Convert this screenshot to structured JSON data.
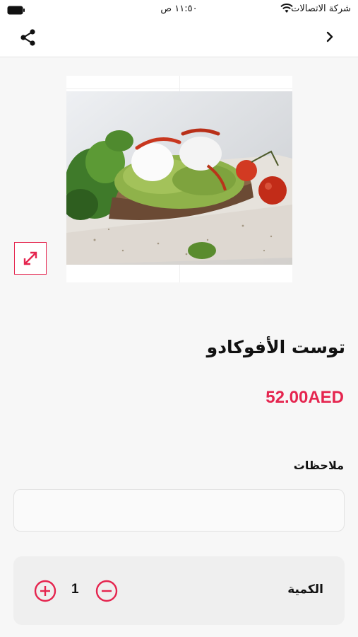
{
  "status_bar": {
    "carrier": "شركة الاتصالات",
    "time": "١١:٥٠ ص",
    "icons": [
      "wifi-icon",
      "battery-icon"
    ]
  },
  "nav": {
    "icons": [
      "share-icon",
      "chevron-right-icon"
    ]
  },
  "product": {
    "name": "توست الأفوكادو",
    "price": "52.00AED",
    "image_icon": "expand-icon"
  },
  "notes": {
    "label": "ملاحظات",
    "value": "",
    "placeholder": ""
  },
  "quantity": {
    "label": "الكمية",
    "value": "1",
    "icons": [
      "plus-circle-icon",
      "minus-circle-icon"
    ]
  },
  "colors": {
    "accent": "#e5254f",
    "background": "#f7f7f7",
    "card": "#efefef"
  }
}
